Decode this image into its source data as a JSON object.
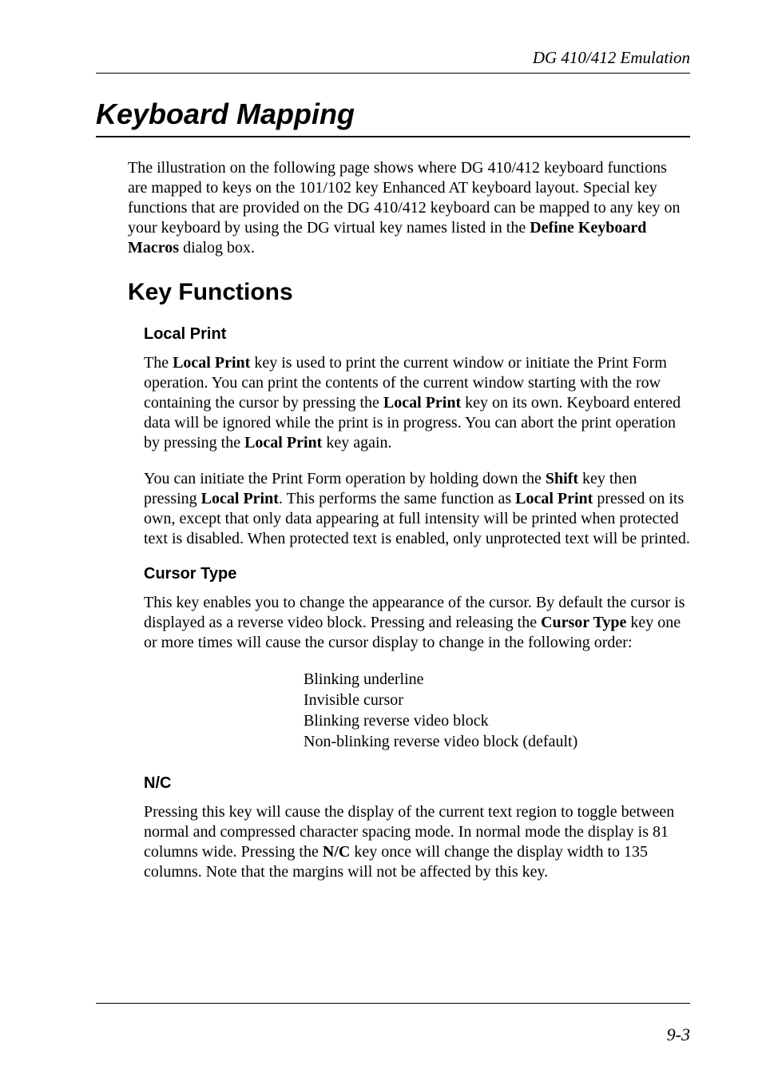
{
  "header": {
    "running": "DG 410/412 Emulation"
  },
  "chapter": {
    "title": "Keyboard Mapping"
  },
  "intro": {
    "p1a": "The illustration on the following page shows where DG 410/412 keyboard functions are mapped to keys on the 101/102 key Enhanced AT keyboard layout. Special key functions that are provided on the DG 410/412 keyboard can be mapped to any key on your keyboard by using the DG virtual key names listed in the ",
    "p1b_bold": "Define Keyboard Macros",
    "p1c": " dialog box."
  },
  "section": {
    "title": "Key Functions"
  },
  "local_print": {
    "heading": "Local Print",
    "p1a": "The ",
    "p1b_bold": "Local Print",
    "p1c": " key is used to print the current window or initiate the Print Form operation. You can print the contents of the current window starting with the row containing the cursor by pressing the ",
    "p1d_bold": "Local Print",
    "p1e": " key on its own. Keyboard entered data will be ignored while the print is in progress. You can abort the print operation by pressing the ",
    "p1f_bold": "Local Print",
    "p1g": " key again.",
    "p2a": "You can initiate the Print Form operation by holding down the ",
    "p2b_bold": "Shift",
    "p2c": " key then pressing ",
    "p2d_bold": "Local Print",
    "p2e": ". This performs the same function as ",
    "p2f_bold": "Local Print",
    "p2g": " pressed on its own, except that only data appearing at full intensity will be printed when protected text is disabled. When protected text is enabled, only unprotected text will be printed."
  },
  "cursor_type": {
    "heading": "Cursor Type",
    "p1a": "This key enables you to change the appearance of the cursor. By default the cursor is displayed as a reverse video block. Pressing and releasing the ",
    "p1b_bold": "Cursor Type",
    "p1c": " key one or more times will cause the cursor display to change in the following order:",
    "list": {
      "l1": "Blinking underline",
      "l2": "Invisible cursor",
      "l3": "Blinking reverse video block",
      "l4": "Non-blinking reverse video block (default)"
    }
  },
  "nc": {
    "heading": "N/C",
    "p1a": "Pressing this key will cause the display of the current text region to toggle between normal and compressed character spacing mode. In normal mode the display is 81 columns wide. Pressing the ",
    "p1b_bold": "N/C",
    "p1c": " key once will change the display width to 135 columns. Note that the margins will not be affected by this key."
  },
  "footer": {
    "page": "9-3"
  }
}
